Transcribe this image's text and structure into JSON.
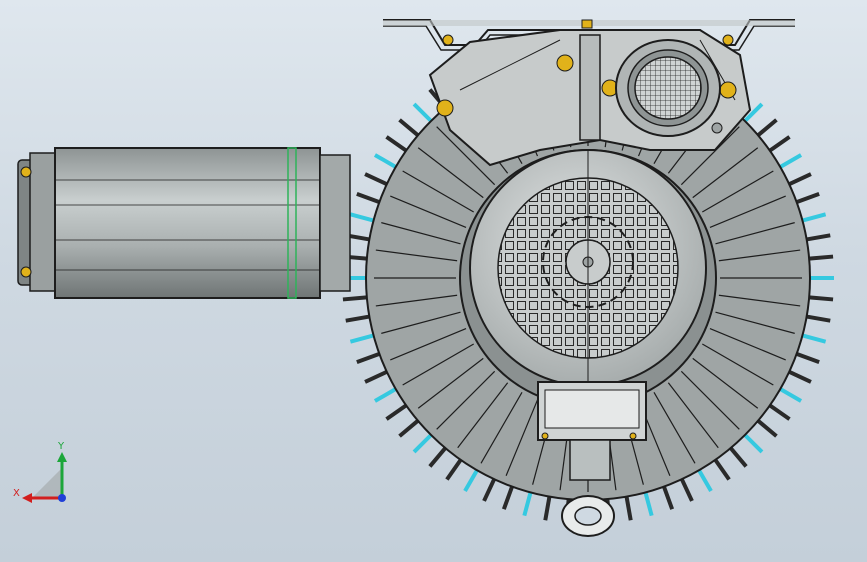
{
  "triad": {
    "x_label": "X",
    "y_label": "Y",
    "x_color": "#d21e1e",
    "y_color": "#1ca63a",
    "z_color": "#1f3fd8"
  },
  "colors": {
    "background_top": "#dfe7ee",
    "background_bottom": "#c4cfd9",
    "metal": "#b9bfbf",
    "fin_accent": "#35c9e0",
    "fastener": "#e1b21a",
    "edge": "#1d1d1d",
    "mark": "#2fb35a"
  },
  "model": {
    "type": "CAD assembly",
    "view": "front"
  }
}
